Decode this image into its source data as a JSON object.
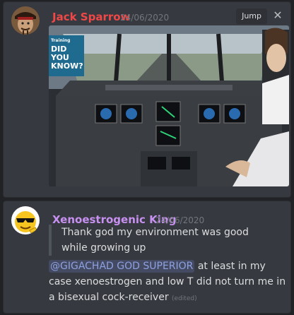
{
  "messages": [
    {
      "author": "Jack Sparrow",
      "author_color": "#f04747",
      "timestamp": "24/06/2020",
      "avatar_icon": "pirate-avatar-icon",
      "image_badge": {
        "brand": "Training",
        "line1": "DID",
        "line2": "YOU",
        "line3": "KNOW?"
      }
    },
    {
      "author": "Xenoestrogenic King",
      "author_color": "#c790f1",
      "timestamp": "24/06/2020",
      "avatar_icon": "cool-emoji-avatar-icon",
      "quote_lines": [
        "Thank god my environment was good",
        "while growing up"
      ],
      "mention": "@GIGACHAD GOD SUPERIOR",
      "text_after_mention": " at least in my case xenoestrogen and low T did not turn me in a bisexual cock-receiver",
      "edited": "(edited)"
    }
  ],
  "toolbar": {
    "jump_label": "Jump",
    "close_glyph": "✕"
  },
  "colors": {
    "background": "#202225",
    "card": "#36393f",
    "mention_text": "#8ea1e1"
  }
}
